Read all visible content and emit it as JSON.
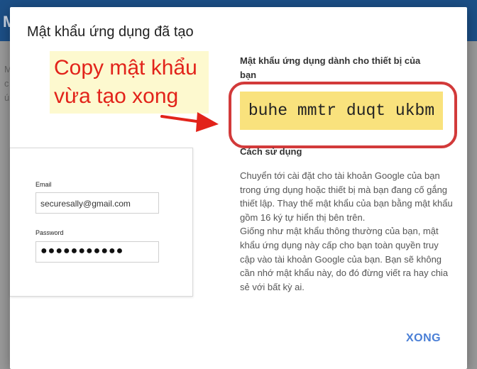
{
  "background": {
    "topbar_letter": "M",
    "left_text_lines": [
      "M",
      "c",
      "ú"
    ]
  },
  "dialog": {
    "title": "Mật khẩu ứng dụng đã tạo",
    "annotation": {
      "line1": "Copy mật khẩu",
      "line2": "vừa tạo xong",
      "color": "#e2231a"
    },
    "login_card": {
      "email_label": "Email",
      "email_value": "securesally@gmail.com",
      "password_label": "Password",
      "password_value": "●●●●●●●●●●●"
    },
    "device_label": "Mật khẩu ứng dụng dành cho thiết bị của bạn",
    "generated_password": "buhe mmtr duqt ukbm",
    "usage_title": "Cách sử dụng",
    "usage_paragraph1": "Chuyển tới cài đặt cho tài khoản Google của bạn trong ứng dụng hoặc thiết bị mà bạn đang cố gắng thiết lập. Thay thế mật khẩu của bạn bằng mật khẩu gồm 16 ký tự hiển thị bên trên.",
    "usage_paragraph2": "Giống như mật khẩu thông thường của bạn, mật khẩu ứng dụng này cấp cho bạn toàn quyền truy cập vào tài khoản Google của bạn. Bạn sẽ không cần nhớ mật khẩu này, do đó đừng viết ra hay chia sẻ với bất kỳ ai.",
    "done_label": "XONG"
  },
  "colors": {
    "accent": "#4a7fd6",
    "password_highlight": "#f9e27d",
    "circle": "#d23a3a"
  }
}
